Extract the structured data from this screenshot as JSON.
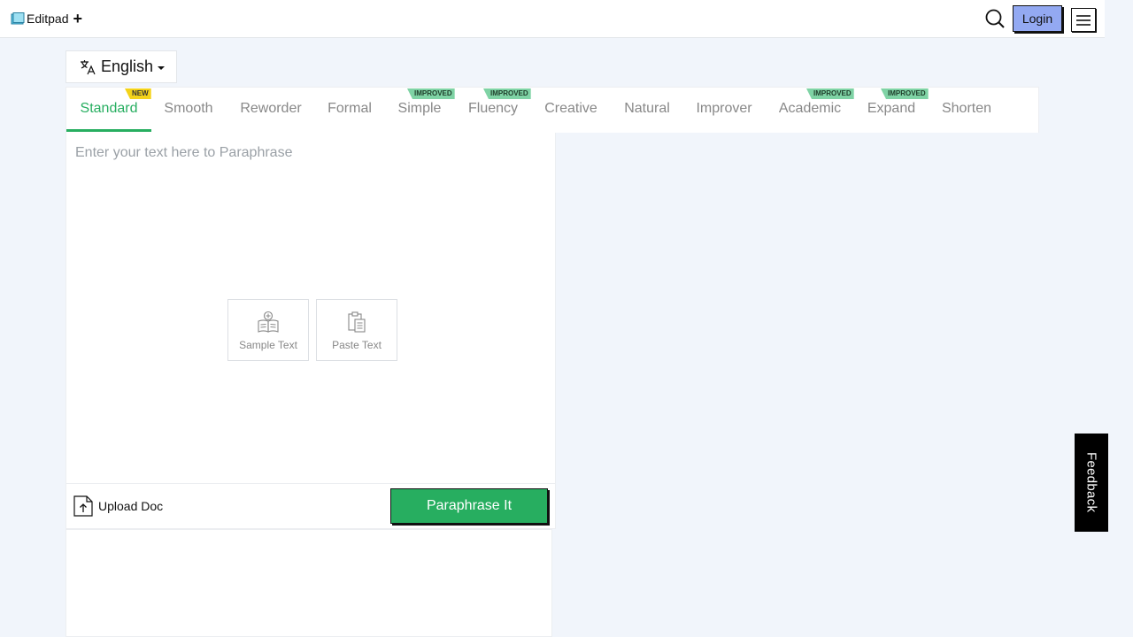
{
  "header": {
    "logo_text": "Editpad",
    "logo_plus": "+",
    "login_label": "Login"
  },
  "language": {
    "selected": "English"
  },
  "modes": [
    {
      "label": "Standard",
      "badge": "NEW",
      "active": true
    },
    {
      "label": "Smooth",
      "badge": ""
    },
    {
      "label": "Reworder",
      "badge": ""
    },
    {
      "label": "Formal",
      "badge": ""
    },
    {
      "label": "Simple",
      "badge": "IMPROVED"
    },
    {
      "label": "Fluency",
      "badge": "IMPROVED"
    },
    {
      "label": "Creative",
      "badge": ""
    },
    {
      "label": "Natural",
      "badge": ""
    },
    {
      "label": "Improver",
      "badge": ""
    },
    {
      "label": "Academic",
      "badge": "IMPROVED"
    },
    {
      "label": "Expand",
      "badge": "IMPROVED"
    },
    {
      "label": "Shorten",
      "badge": ""
    }
  ],
  "editor": {
    "placeholder": "Enter your text here to Paraphrase",
    "sample_label": "Sample Text",
    "paste_label": "Paste Text"
  },
  "actions": {
    "upload_label": "Upload Doc",
    "paraphrase_label": "Paraphrase It"
  },
  "feedback_label": "Feedback",
  "colors": {
    "accent": "#27ae60",
    "login": "#93a9f2",
    "badge_new": "#f4d31a",
    "badge_improved": "#7fd3a5"
  }
}
